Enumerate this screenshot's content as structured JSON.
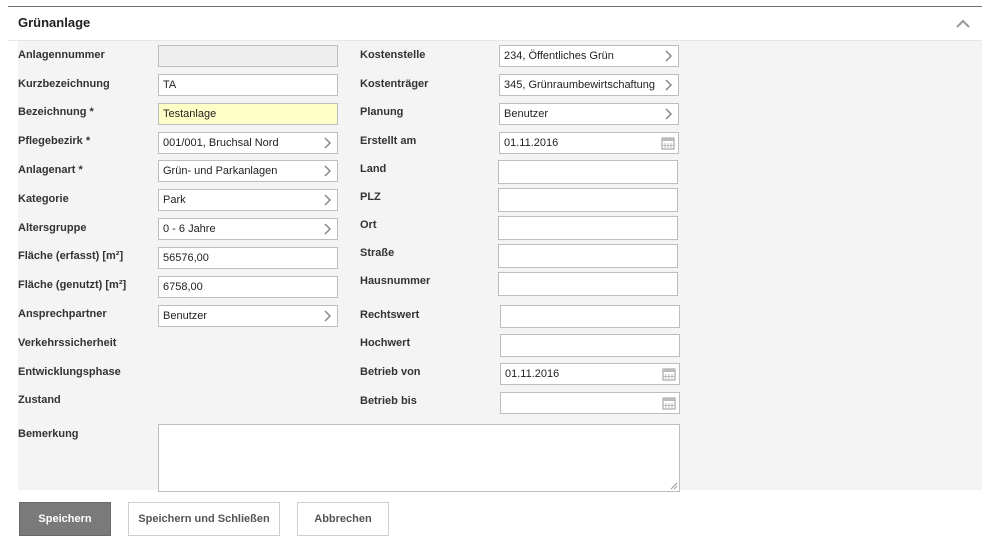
{
  "section": {
    "title": "Grünanlage"
  },
  "left": {
    "anlagennummer": {
      "label": "Anlagennummer",
      "value": ""
    },
    "kurzbezeichnung": {
      "label": "Kurzbezeichnung",
      "value": "TA"
    },
    "bezeichnung": {
      "label": "Bezeichnung *",
      "value": "Testanlage"
    },
    "pflegebezirk": {
      "label": "Pflegebezirk *",
      "value": "001/001, Bruchsal Nord"
    },
    "anlagenart": {
      "label": "Anlagenart *",
      "value": "Grün- und Parkanlagen"
    },
    "kategorie": {
      "label": "Kategorie",
      "value": "Park"
    },
    "altersgruppe": {
      "label": "Altersgruppe",
      "value": "0 - 6 Jahre"
    },
    "flaeche_erfasst": {
      "label": "Fläche (erfasst) [m²]",
      "value": "56576,00"
    },
    "flaeche_genutzt": {
      "label": "Fläche (genutzt) [m²]",
      "value": "6758,00"
    },
    "ansprechpartner": {
      "label": "Ansprechpartner",
      "value": "Benutzer"
    },
    "verkehrssicherheit": {
      "label": "Verkehrssicherheit"
    },
    "entwicklungsphase": {
      "label": "Entwicklungsphase"
    },
    "zustand": {
      "label": "Zustand"
    },
    "bemerkung": {
      "label": "Bemerkung",
      "value": ""
    }
  },
  "right": {
    "kostenstelle": {
      "label": "Kostenstelle",
      "value": "234, Öffentliches Grün"
    },
    "kostentraeger": {
      "label": "Kostenträger",
      "value": "345, Grünraumbewirtschaftung"
    },
    "planung": {
      "label": "Planung",
      "value": "Benutzer"
    },
    "erstellt_am": {
      "label": "Erstellt am",
      "value": "01.11.2016"
    },
    "land": {
      "label": "Land",
      "value": ""
    },
    "plz": {
      "label": "PLZ",
      "value": ""
    },
    "ort": {
      "label": "Ort",
      "value": ""
    },
    "strasse": {
      "label": "Straße",
      "value": ""
    },
    "hausnummer": {
      "label": "Hausnummer",
      "value": ""
    },
    "rechtswert": {
      "label": "Rechtswert",
      "value": ""
    },
    "hochwert": {
      "label": "Hochwert",
      "value": ""
    },
    "betrieb_von": {
      "label": "Betrieb von",
      "value": "01.11.2016"
    },
    "betrieb_bis": {
      "label": "Betrieb bis",
      "value": ""
    }
  },
  "buttons": {
    "save": "Speichern",
    "save_close": "Speichern und Schließen",
    "cancel": "Abbrechen"
  },
  "icons": {
    "collapse": "chevron-up-icon",
    "select": "chevron-right-icon",
    "date": "calendar-icon"
  },
  "colors": {
    "required_field": "#ffffc8",
    "disabled_field": "#eeeeee",
    "primary_button": "#7a7a7a",
    "panel_background": "#f4f4f4"
  }
}
